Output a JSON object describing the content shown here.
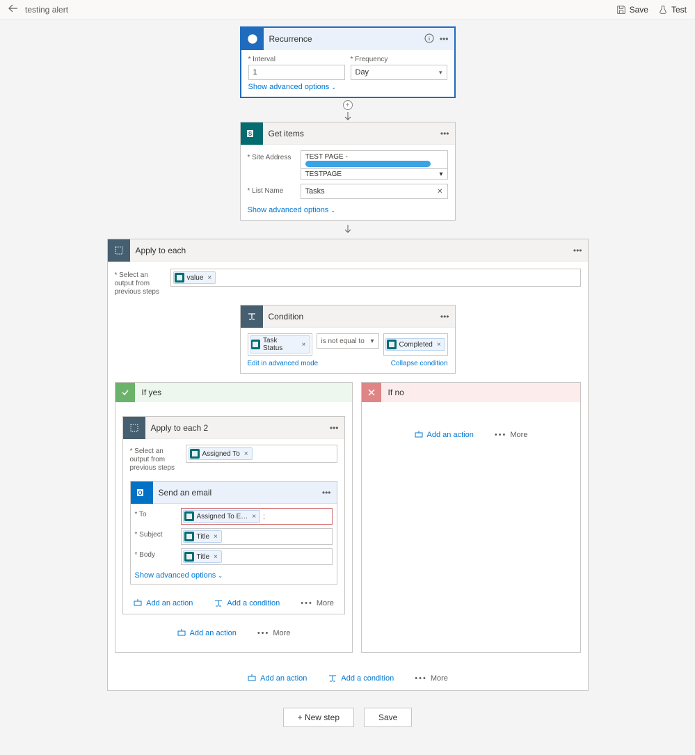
{
  "topbar": {
    "title": "testing alert",
    "save": "Save",
    "test": "Test"
  },
  "recurrence": {
    "title": "Recurrence",
    "interval_label": "Interval",
    "interval_value": "1",
    "frequency_label": "Frequency",
    "frequency_value": "Day",
    "show_adv": "Show advanced options"
  },
  "getitems": {
    "title": "Get items",
    "site_label": "Site Address",
    "site_line1": "TEST PAGE -",
    "site_line2": "TESTPAGE",
    "list_label": "List Name",
    "list_value": "Tasks",
    "show_adv": "Show advanced options"
  },
  "apply": {
    "title": "Apply to each",
    "select_label": "Select an output from previous steps",
    "token_value": "value"
  },
  "condition": {
    "title": "Condition",
    "left_token": "Task Status",
    "op": "is not equal to",
    "right_token": "Completed",
    "edit_link": "Edit in advanced mode",
    "collapse_link": "Collapse condition"
  },
  "branch": {
    "yes_label": "If yes",
    "no_label": "If no"
  },
  "apply2": {
    "title": "Apply to each 2",
    "select_label": "Select an output from previous steps",
    "token": "Assigned To"
  },
  "email": {
    "title": "Send an email",
    "to_label": "To",
    "to_token": "Assigned To E…",
    "subject_label": "Subject",
    "subject_token": "Title",
    "body_label": "Body",
    "body_token": "Title",
    "show_adv": "Show advanced options"
  },
  "actions": {
    "add_action": "Add an action",
    "add_condition": "Add a condition",
    "more": "More"
  },
  "bottom": {
    "new_step": "+ New step",
    "save": "Save"
  }
}
